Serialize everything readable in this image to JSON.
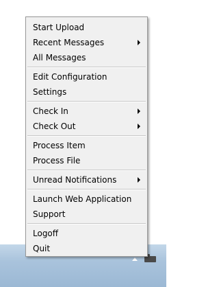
{
  "menu": {
    "items": [
      {
        "label": "Start Upload"
      },
      {
        "label": "Recent Messages"
      },
      {
        "label": "All Messages"
      },
      {
        "label": "Edit Configuration"
      },
      {
        "label": "Settings"
      },
      {
        "label": "Check In"
      },
      {
        "label": "Check Out"
      },
      {
        "label": "Process Item"
      },
      {
        "label": "Process File"
      },
      {
        "label": "Unread Notifications"
      },
      {
        "label": "Launch Web Application"
      },
      {
        "label": "Support"
      },
      {
        "label": "Logoff"
      },
      {
        "label": "Quit"
      }
    ]
  },
  "icons": {
    "submenu": "chevron-right-icon",
    "tray_overflow": "chevron-up-icon",
    "tray_app": "folder-icon"
  },
  "colors": {
    "menu_bg": "#f0f0f0",
    "menu_border": "#979797",
    "taskbar": "#a9c3dc"
  }
}
